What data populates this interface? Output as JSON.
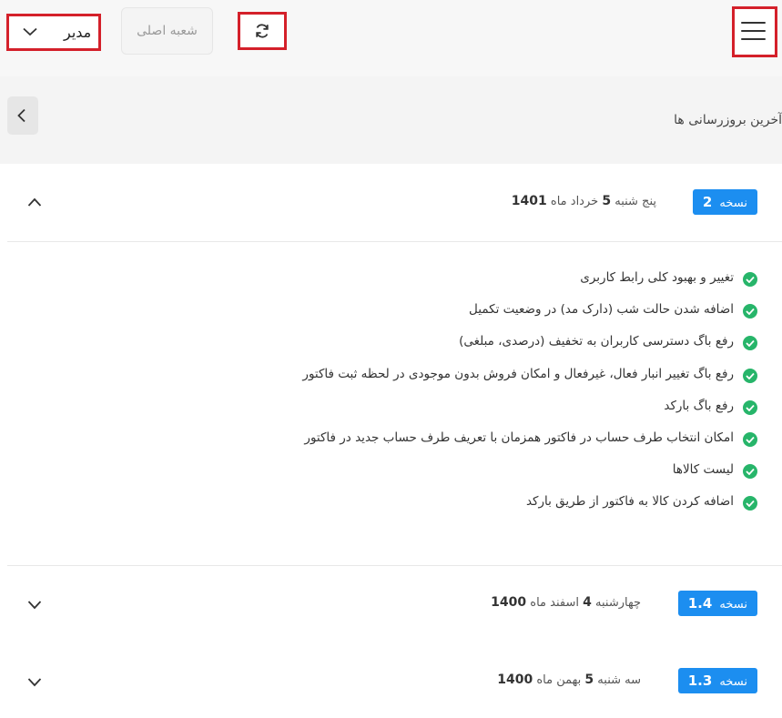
{
  "topbar": {
    "role": "مدیر",
    "branch_button": "شعبه اصلی"
  },
  "header": {
    "title": "آخرین بروزرسانی ها"
  },
  "versions": [
    {
      "badge_prefix": "نسخه",
      "badge_number": "2",
      "date_prefix": "پنج شنبه",
      "day": "5",
      "month": "خرداد ماه",
      "year": "1401",
      "expanded": true,
      "changes": [
        "تغییر و بهبود کلی رابط کاربری",
        "اضافه شدن حالت شب (دارک مد) در وضعیت تکمیل",
        "رفع باگ دسترسی کاربران به تخفیف (درصدی، مبلغی)",
        "رفع باگ تغییر انبار فعال، غیرفعال و امکان فروش بدون موجودی در لحظه ثبت فاکتور",
        "رفع باگ بارکد",
        "امکان انتخاب طرف حساب در فاکتور همزمان با تعریف طرف حساب جدید در فاکتور",
        "لیست کالاها",
        "اضافه کردن کالا به فاکتور از طریق بارکد"
      ]
    },
    {
      "badge_prefix": "نسخه",
      "badge_number": "1.4",
      "date_prefix": "چهارشنبه",
      "day": "4",
      "month": "اسفند ماه",
      "year": "1400",
      "expanded": false
    },
    {
      "badge_prefix": "نسخه",
      "badge_number": "1.3",
      "date_prefix": "سه شنبه",
      "day": "5",
      "month": "بهمن ماه",
      "year": "1400",
      "expanded": false
    }
  ],
  "colors": {
    "badge": "#1c8ef0",
    "check": "#27b56a",
    "highlight_border": "#d4202a"
  },
  "icons": {
    "menu": "hamburger-icon",
    "refresh": "refresh-icon",
    "role_dropdown": "chevron-down-icon",
    "back": "chevron-left-icon",
    "collapse": "chevron-up-icon",
    "expand": "chevron-down-icon",
    "change": "check-circle-icon"
  }
}
